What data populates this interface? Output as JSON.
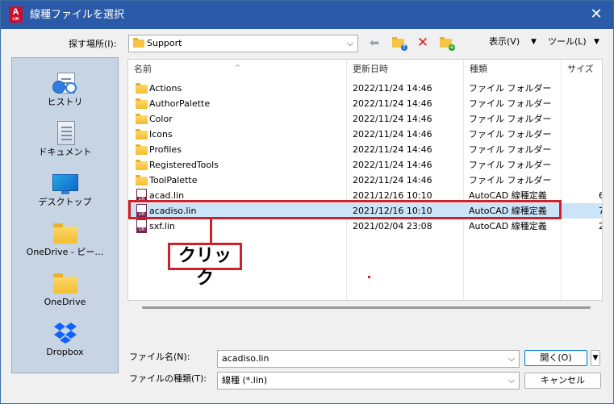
{
  "window": {
    "title": "線種ファイルを選択",
    "logo_text": "A",
    "logo_sub": "LIN",
    "close_glyph": "✕"
  },
  "lookin": {
    "label": "探す場所(I):",
    "value": "Support"
  },
  "toolbar": {
    "back_glyph": "⬅",
    "delete_glyph": "✕",
    "up_badge": "↑",
    "new_badge": "+",
    "view_label": "表示(V)",
    "tools_label": "ツール(L)",
    "drop_glyph": "▼"
  },
  "places": [
    {
      "label": "ヒストリ",
      "icon": "history-icon"
    },
    {
      "label": "ドキュメント",
      "icon": "documents-icon"
    },
    {
      "label": "デスクトップ",
      "icon": "desktop-icon"
    },
    {
      "label": "OneDrive - ピー…",
      "icon": "folder-icon"
    },
    {
      "label": "OneDrive",
      "icon": "folder-icon"
    },
    {
      "label": "Dropbox",
      "icon": "dropbox-icon"
    }
  ],
  "columns": {
    "name": "名前",
    "date": "更新日時",
    "type": "種類",
    "size": "サイズ",
    "sort_glyph": "^"
  },
  "rows": [
    {
      "name": "Actions",
      "date": "2022/11/24 14:46",
      "type": "ファイル フォルダー",
      "size": "",
      "kind": "folder"
    },
    {
      "name": "AuthorPalette",
      "date": "2022/11/24 14:46",
      "type": "ファイル フォルダー",
      "size": "",
      "kind": "folder"
    },
    {
      "name": "Color",
      "date": "2022/11/24 14:46",
      "type": "ファイル フォルダー",
      "size": "",
      "kind": "folder"
    },
    {
      "name": "Icons",
      "date": "2022/11/24 14:46",
      "type": "ファイル フォルダー",
      "size": "",
      "kind": "folder"
    },
    {
      "name": "Profiles",
      "date": "2022/11/24 14:46",
      "type": "ファイル フォルダー",
      "size": "",
      "kind": "folder"
    },
    {
      "name": "RegisteredTools",
      "date": "2022/11/24 14:46",
      "type": "ファイル フォルダー",
      "size": "",
      "kind": "folder"
    },
    {
      "name": "ToolPalette",
      "date": "2022/11/24 14:46",
      "type": "ファイル フォルダー",
      "size": "",
      "kind": "folder"
    },
    {
      "name": "acad.lin",
      "date": "2021/12/16 10:10",
      "type": "AutoCAD 線種定義",
      "size": "6",
      "kind": "lin"
    },
    {
      "name": "acadiso.lin",
      "date": "2021/12/16 10:10",
      "type": "AutoCAD 線種定義",
      "size": "7",
      "kind": "lin",
      "selected": true
    },
    {
      "name": "sxf.lin",
      "date": "2021/02/04 23:08",
      "type": "AutoCAD 線種定義",
      "size": "2",
      "kind": "lin"
    }
  ],
  "annotation": {
    "label": "クリック",
    "color": "#d0202a"
  },
  "bottom": {
    "filename_label": "ファイル名(N):",
    "filename_value": "acadiso.lin",
    "filetype_label": "ファイルの種類(T):",
    "filetype_value": "線種 (*.lin)",
    "open_label": "開く(O)",
    "cancel_label": "キャンセル",
    "drop_glyph": "▼",
    "combo_arrow": "⌵"
  },
  "colors": {
    "titlebar": "#2b5ba8",
    "selection": "#cce4f7",
    "places_bg": "#c7d4e3",
    "accent_red": "#d0202a"
  }
}
